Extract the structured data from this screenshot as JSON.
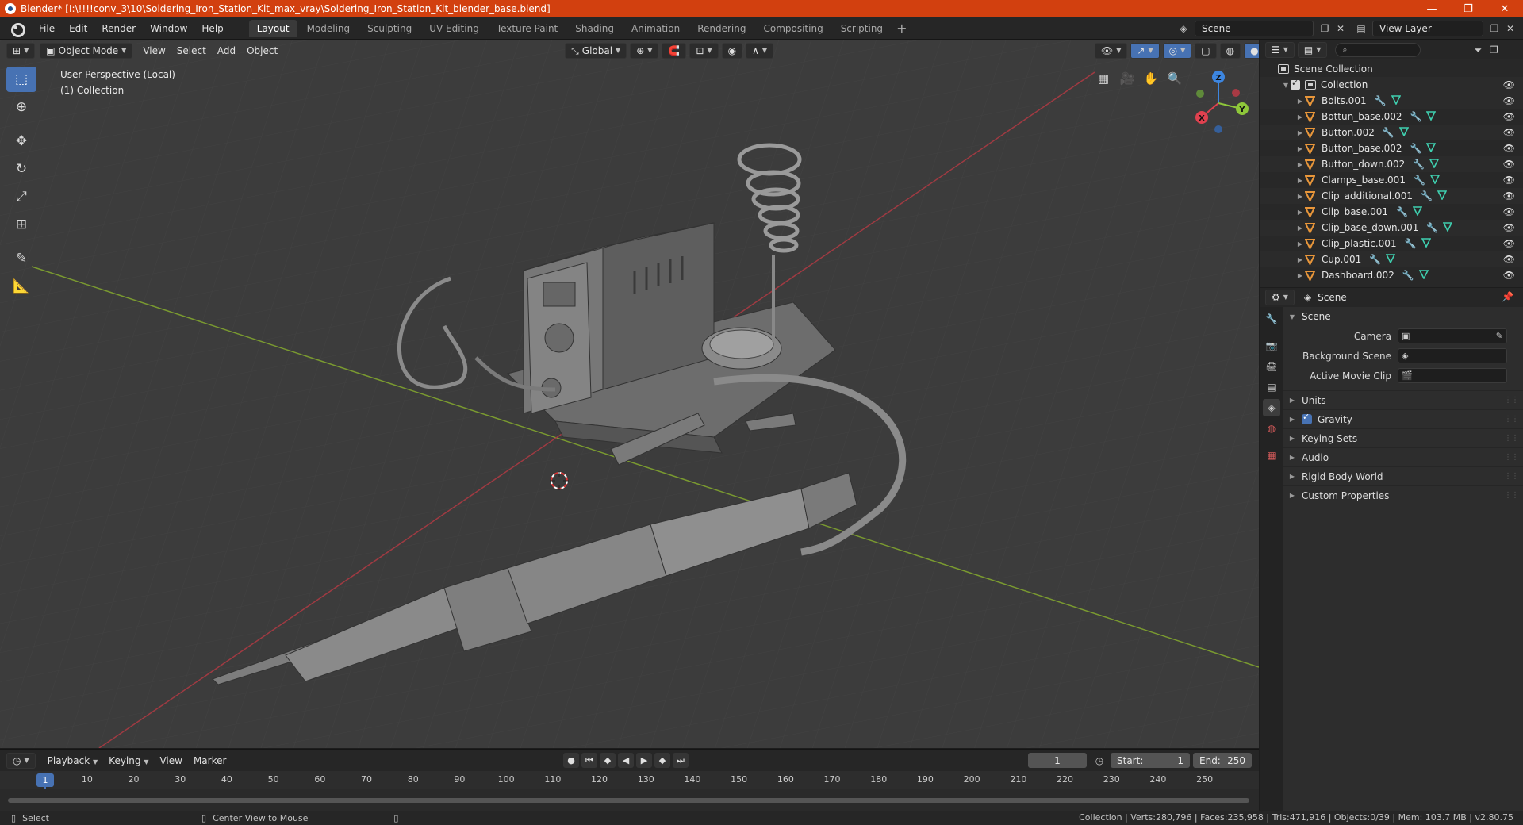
{
  "window": {
    "title": "Blender* [I:\\!!!!conv_3\\10\\Soldering_Iron_Station_Kit_max_vray\\Soldering_Iron_Station_Kit_blender_base.blend]",
    "minimize": "—",
    "maximize": "❐",
    "close": "✕"
  },
  "menu": [
    "File",
    "Edit",
    "Render",
    "Window",
    "Help"
  ],
  "workspaces": [
    "Layout",
    "Modeling",
    "Sculpting",
    "UV Editing",
    "Texture Paint",
    "Shading",
    "Animation",
    "Rendering",
    "Compositing",
    "Scripting"
  ],
  "active_workspace": "Layout",
  "scene_selector": "Scene",
  "view_layer_selector": "View Layer",
  "viewport": {
    "mode": "Object Mode",
    "menus": [
      "View",
      "Select",
      "Add",
      "Object"
    ],
    "transform_orientation": "Global",
    "info_line1": "User Perspective (Local)",
    "info_line2": "(1) Collection",
    "gizmo": {
      "z": "Z",
      "y": "Y",
      "x": "X"
    }
  },
  "timeline": {
    "menus": [
      "Playback",
      "Keying",
      "View",
      "Marker"
    ],
    "current_frame": "1",
    "start_label": "Start:",
    "start": "1",
    "end_label": "End:",
    "end": "250",
    "ticks": [
      "10",
      "20",
      "30",
      "40",
      "50",
      "60",
      "70",
      "80",
      "90",
      "100",
      "110",
      "120",
      "130",
      "140",
      "150",
      "160",
      "170",
      "180",
      "190",
      "200",
      "210",
      "220",
      "230",
      "240",
      "250"
    ],
    "cursor_frame": "1"
  },
  "status": {
    "left1": "Select",
    "left2": "Center View to Mouse",
    "right": "Collection | Verts:280,796 | Faces:235,958 | Tris:471,916 | Objects:0/39 | Mem: 103.7 MB | v2.80.75"
  },
  "outliner": {
    "root": "Scene Collection",
    "collection": "Collection",
    "items": [
      "Bolts.001",
      "Bottun_base.002",
      "Button.002",
      "Button_base.002",
      "Button_down.002",
      "Clamps_base.001",
      "Clip_additional.001",
      "Clip_base.001",
      "Clip_base_down.001",
      "Clip_plastic.001",
      "Cup.001",
      "Dashboard.002"
    ]
  },
  "properties": {
    "header_title": "Scene",
    "panel": "Scene",
    "camera_label": "Camera",
    "background_scene_label": "Background Scene",
    "active_movie_clip_label": "Active Movie Clip",
    "subpanels": [
      "Units",
      "Gravity",
      "Keying Sets",
      "Audio",
      "Rigid Body World",
      "Custom Properties"
    ]
  },
  "colors": {
    "titlebar": "#d2400f",
    "accent": "#4772b3",
    "object_icon": "#e8963a",
    "mesh_icon": "#3fd0b0",
    "x_axis": "#e0414f",
    "y_axis": "#8ec73a",
    "z_axis": "#3d86e0"
  }
}
